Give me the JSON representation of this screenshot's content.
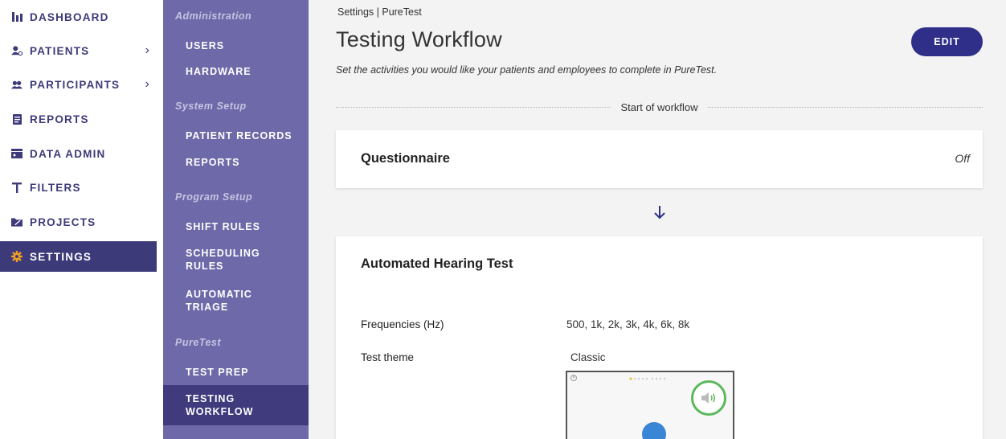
{
  "nav": {
    "items": [
      {
        "label": "DASHBOARD",
        "icon": "bar-chart-icon"
      },
      {
        "label": "PATIENTS",
        "icon": "patient-icon",
        "chevron": "›"
      },
      {
        "label": "PARTICIPANTS",
        "icon": "participants-icon",
        "chevron": "›"
      },
      {
        "label": "REPORTS",
        "icon": "document-icon"
      },
      {
        "label": "DATA ADMIN",
        "icon": "data-admin-icon"
      },
      {
        "label": "FILTERS",
        "icon": "filter-icon"
      },
      {
        "label": "PROJECTS",
        "icon": "folder-icon"
      },
      {
        "label": "SETTINGS",
        "icon": "gear-icon",
        "active": true
      }
    ]
  },
  "subnav": {
    "administration": "Administration",
    "users": "USERS",
    "hardware": "HARDWARE",
    "system_setup": "System Setup",
    "patient_records": "PATIENT RECORDS",
    "reports": "REPORTS",
    "program_setup": "Program Setup",
    "shift_rules": "SHIFT RULES",
    "scheduling_rules_1": "SCHEDULING",
    "scheduling_rules_2": "RULES",
    "automatic_triage_1": "AUTOMATIC",
    "automatic_triage_2": "TRIAGE",
    "puretest": "PureTest",
    "test_prep": "TEST PREP",
    "testing_workflow_1": "TESTING",
    "testing_workflow_2": "WORKFLOW"
  },
  "main": {
    "breadcrumb": "Settings | PureTest",
    "title": "Testing Workflow",
    "edit_label": "EDIT",
    "description": "Set the activities you would like your patients and employees to complete in PureTest.",
    "divider_label": "Start of workflow",
    "questionnaire": {
      "title": "Questionnaire",
      "status": "Off"
    },
    "hearing_test": {
      "title": "Automated Hearing Test",
      "frequencies_label": "Frequencies (Hz)",
      "frequencies_value": "500, 1k, 2k, 3k, 4k, 6k, 8k",
      "theme_label": "Test theme",
      "theme_value": "Classic"
    }
  },
  "colors": {
    "primary": "#3d3a7a",
    "subnav": "#6e69a8",
    "button": "#2f2f8a",
    "accent": "#f0a020"
  }
}
